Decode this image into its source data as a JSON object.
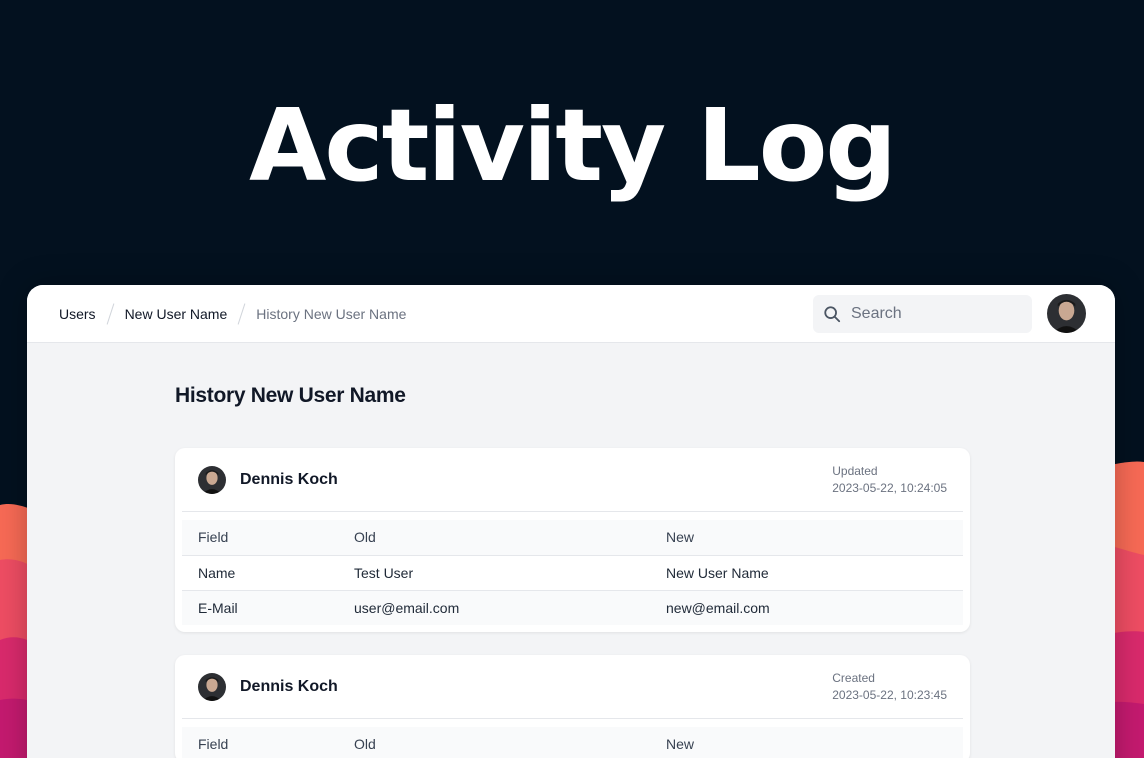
{
  "hero": {
    "title": "Activity Log"
  },
  "breadcrumb": [
    "Users",
    "New User Name",
    "History New User Name"
  ],
  "search": {
    "placeholder": "Search"
  },
  "page": {
    "title": "History New User Name"
  },
  "table_headers": [
    "Field",
    "Old",
    "New"
  ],
  "entries": [
    {
      "author": "Dennis Koch",
      "action": "Updated",
      "timestamp": "2023-05-22, 10:24:05",
      "rows": [
        {
          "field": "Name",
          "old": "Test User",
          "new": "New User Name"
        },
        {
          "field": "E-Mail",
          "old": "user@email.com",
          "new": "new@email.com"
        }
      ]
    },
    {
      "author": "Dennis Koch",
      "action": "Created",
      "timestamp": "2023-05-22, 10:23:45",
      "rows": []
    }
  ],
  "icons": {
    "search": "search-icon",
    "avatar": "user-avatar"
  },
  "colors": {
    "background": "#03111f",
    "wave_orange": "#f76a55",
    "wave_pink": "#e23a6b",
    "wave_magenta": "#c91a6e"
  }
}
